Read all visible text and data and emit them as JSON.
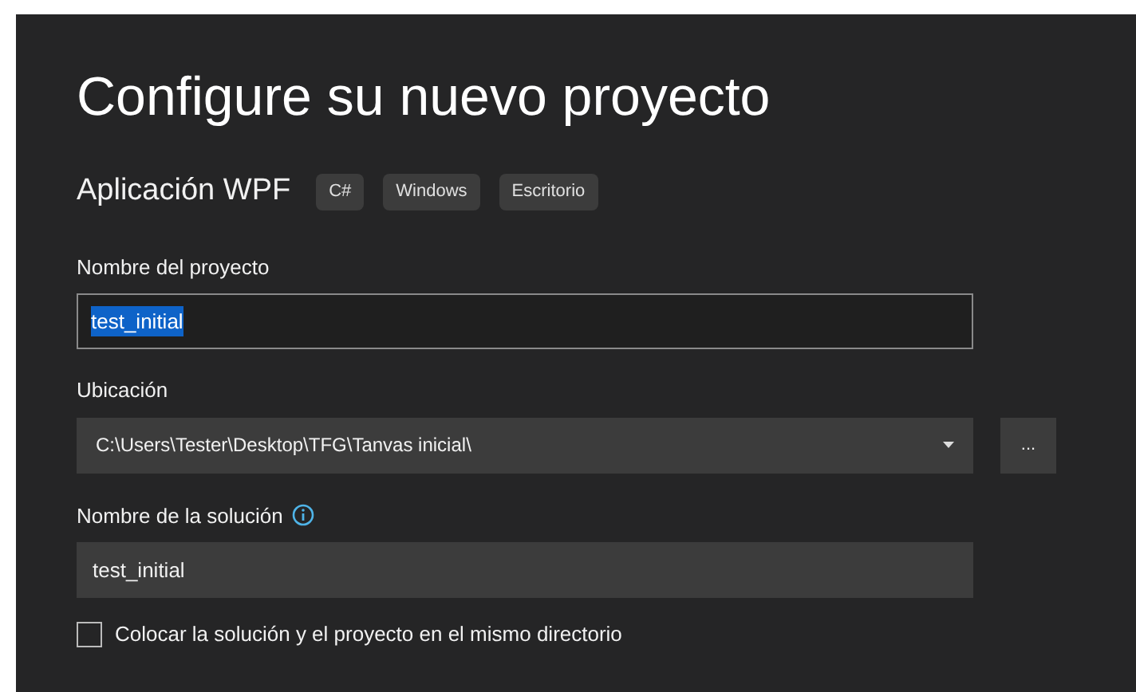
{
  "title": "Configure su nuevo proyecto",
  "template": {
    "name": "Aplicación WPF",
    "tags": [
      "C#",
      "Windows",
      "Escritorio"
    ]
  },
  "project_name": {
    "label": "Nombre del proyecto",
    "value": "test_initial",
    "text_selected": true
  },
  "location": {
    "label": "Ubicación",
    "value": "C:\\Users\\Tester\\Desktop\\TFG\\Tanvas inicial\\",
    "browse": "..."
  },
  "solution_name": {
    "label": "Nombre de la solución",
    "value": "test_initial"
  },
  "same_directory": {
    "label": "Colocar la solución y el proyecto en el mismo directorio",
    "checked": false
  }
}
